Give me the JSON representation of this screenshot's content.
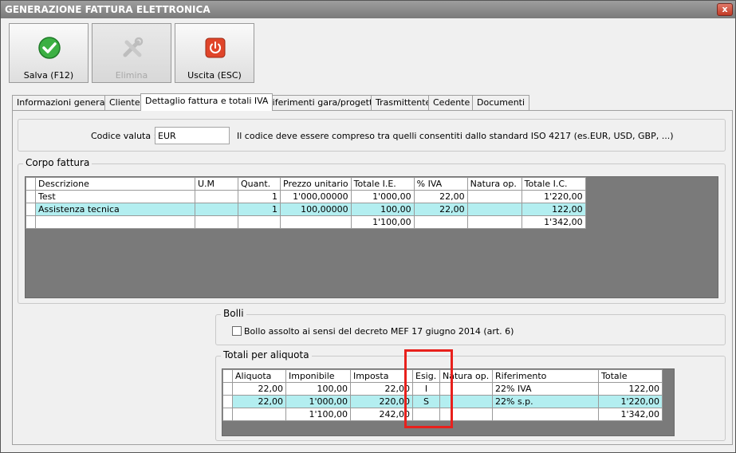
{
  "window": {
    "title": "GENERAZIONE FATTURA ELETTRONICA",
    "close_glyph": "x"
  },
  "toolbar": {
    "save_label": "Salva (F12)",
    "delete_label": "Elimina",
    "exit_label": "Uscita (ESC)"
  },
  "tabs": [
    "Informazioni generali",
    "Cliente",
    "Dettaglio fattura e totali IVA",
    "Riferimenti gara/progetto",
    "Trasmittente",
    "Cedente",
    "Documenti"
  ],
  "currency": {
    "label": "Codice valuta :",
    "value": "EUR",
    "hint": "Il codice deve essere compreso tra quelli consentiti dallo standard ISO 4217 (es.EUR, USD, GBP, ...)"
  },
  "corpo": {
    "title": "Corpo fattura",
    "headers": [
      "Descrizione",
      "U.M",
      "Quant.",
      "Prezzo unitario",
      "Totale I.E.",
      "% IVA",
      "Natura op.",
      "Totale I.C."
    ],
    "rows": [
      [
        "Test",
        "",
        "1",
        "1'000,00000",
        "1'000,00",
        "22,00",
        "",
        "1'220,00"
      ],
      [
        "Assistenza tecnica",
        "",
        "1",
        "100,00000",
        "100,00",
        "22,00",
        "",
        "122,00"
      ],
      [
        "",
        "",
        "",
        "",
        "1'100,00",
        "",
        "",
        "1'342,00"
      ]
    ]
  },
  "bolli": {
    "title": "Bolli",
    "checkbox_label": "Bollo assolto ai sensi del decreto MEF 17 giugno 2014 (art. 6)",
    "checked": false
  },
  "totali": {
    "title": "Totali per aliquota",
    "headers": [
      "Aliquota",
      "Imponibile",
      "Imposta",
      "Esig.",
      "Natura op.",
      "Riferimento",
      "Totale"
    ],
    "rows": [
      [
        "22,00",
        "100,00",
        "22,00",
        "I",
        "",
        "22% IVA",
        "122,00"
      ],
      [
        "22,00",
        "1'000,00",
        "220,00",
        "S",
        "",
        "22% s.p.",
        "1'220,00"
      ],
      [
        "",
        "1'100,00",
        "242,00",
        "",
        "",
        "",
        "1'342,00"
      ]
    ]
  },
  "colors": {
    "highlight_row": "#b3eef0",
    "annotation_box": "#e8201c",
    "grid_background": "#7a7a7a"
  }
}
